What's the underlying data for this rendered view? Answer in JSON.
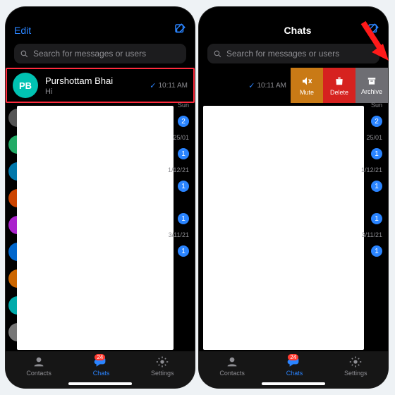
{
  "nav": {
    "edit": "Edit",
    "title": "Chats"
  },
  "search": {
    "placeholder": "Search for messages or users"
  },
  "chat": {
    "initials": "PB",
    "name": "Purshottam Bhai",
    "preview": "Hi",
    "time": "10:11 AM"
  },
  "swipe": {
    "time": "10:11 AM",
    "mute": "Mute",
    "delete": "Delete",
    "archive": "Archive"
  },
  "right": {
    "sun": "Sun",
    "d1": "25/01",
    "d2": "1/12/21",
    "d3": "3/11/21"
  },
  "badges": {
    "b1": "2",
    "b2": "1",
    "b3": "1",
    "b4": "1",
    "b5": "1"
  },
  "tabs": {
    "contacts": "Contacts",
    "chats": "Chats",
    "settings": "Settings",
    "chat_count": "24"
  },
  "avatar_colors": [
    "#555",
    "#2a6",
    "#07a",
    "#c40",
    "#a2c",
    "#06c",
    "#c60",
    "#0aa",
    "#777"
  ]
}
